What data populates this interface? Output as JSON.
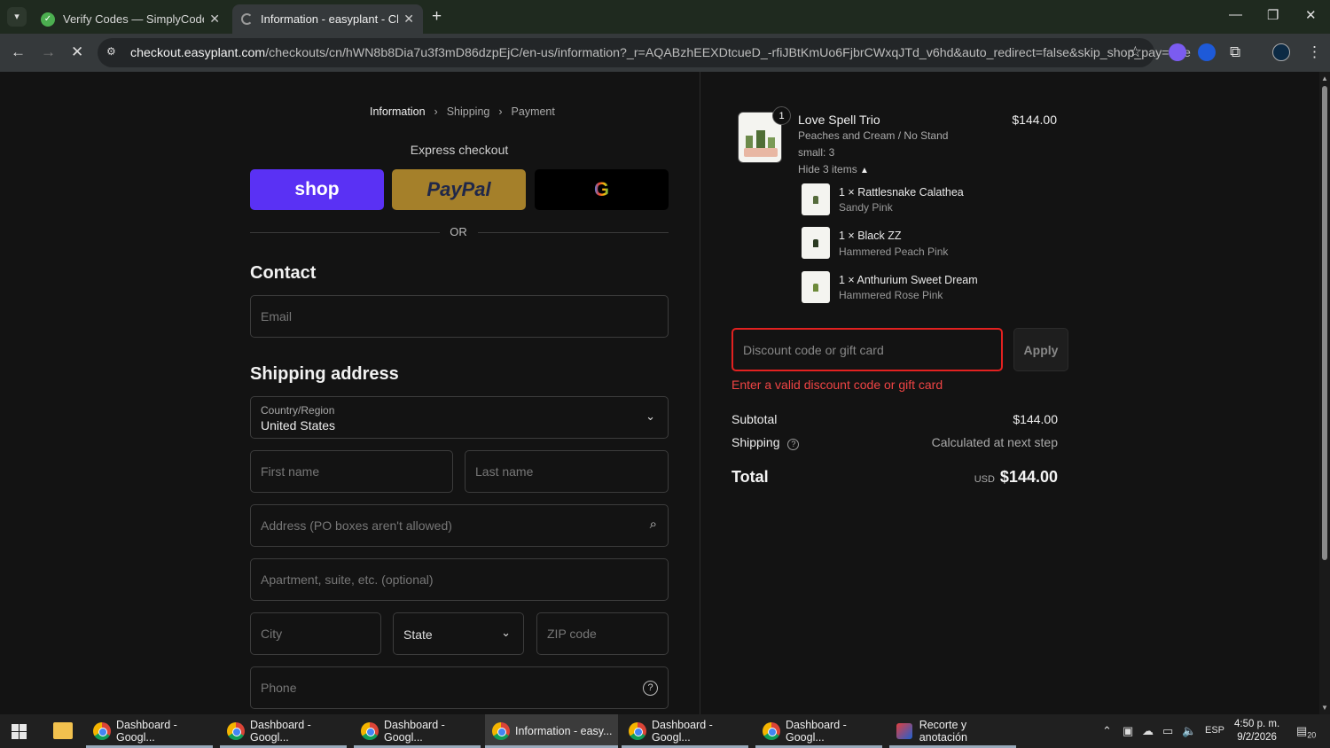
{
  "browser": {
    "tabs": [
      {
        "title": "Verify Codes — SimplyCodes"
      },
      {
        "title": "Information - easyplant - Check"
      }
    ],
    "url_domain": "checkout.easyplant.com",
    "url_path": "/checkouts/cn/hWN8b8Dia7u3f3mD86dzpEjC/en-us/information?_r=AQABzhEEXDtcueD_-rfiJBtKmUo6FjbrCWxqJTd_v6hd&auto_redirect=false&skip_shop_pay=true"
  },
  "breadcrumb": {
    "information": "Information",
    "shipping": "Shipping",
    "payment": "Payment",
    "sep": "›"
  },
  "express": {
    "title": "Express checkout",
    "shop": "shop",
    "paypal": "PayPal",
    "google": "G",
    "or": "OR"
  },
  "contact": {
    "heading": "Contact",
    "email_placeholder": "Email"
  },
  "shipping": {
    "heading": "Shipping address",
    "country_label": "Country/Region",
    "country_value": "United States",
    "first_name": "First name",
    "last_name": "Last name",
    "address": "Address (PO boxes aren't allowed)",
    "apartment": "Apartment, suite, etc. (optional)",
    "city": "City",
    "state": "State",
    "zip": "ZIP code",
    "phone": "Phone",
    "help": "?"
  },
  "summary": {
    "product": {
      "qty": "1",
      "name": "Love Spell Trio",
      "variant1": "Peaches and Cream / No Stand",
      "variant2": "small: 3",
      "price": "$144.00"
    },
    "hide_items": "Hide 3 items",
    "items": [
      {
        "name": "1 × Rattlesnake Calathea",
        "variant": "Sandy Pink"
      },
      {
        "name": "1 × Black ZZ",
        "variant": "Hammered Peach Pink"
      },
      {
        "name": "1 × Anthurium Sweet Dream",
        "variant": "Hammered Rose Pink"
      }
    ],
    "discount_placeholder": "Discount code or gift card",
    "apply": "Apply",
    "error": "Enter a valid discount code or gift card",
    "subtotal_label": "Subtotal",
    "subtotal_value": "$144.00",
    "shipping_label": "Shipping",
    "shipping_value": "Calculated at next step",
    "total_label": "Total",
    "currency": "USD",
    "total_value": "$144.00"
  },
  "taskbar": {
    "items": [
      "Dashboard - Googl...",
      "Dashboard - Googl...",
      "Dashboard - Googl...",
      "Information - easy...",
      "Dashboard - Googl...",
      "Dashboard - Googl...",
      "Recorte y anotación"
    ],
    "lang": "ESP",
    "time": "4:50 p. m.",
    "date": "9/2/2026",
    "notif": "20"
  },
  "colors": {
    "shop": "#5a31f4",
    "paypal": "#ffc439",
    "error": "#e22120"
  }
}
